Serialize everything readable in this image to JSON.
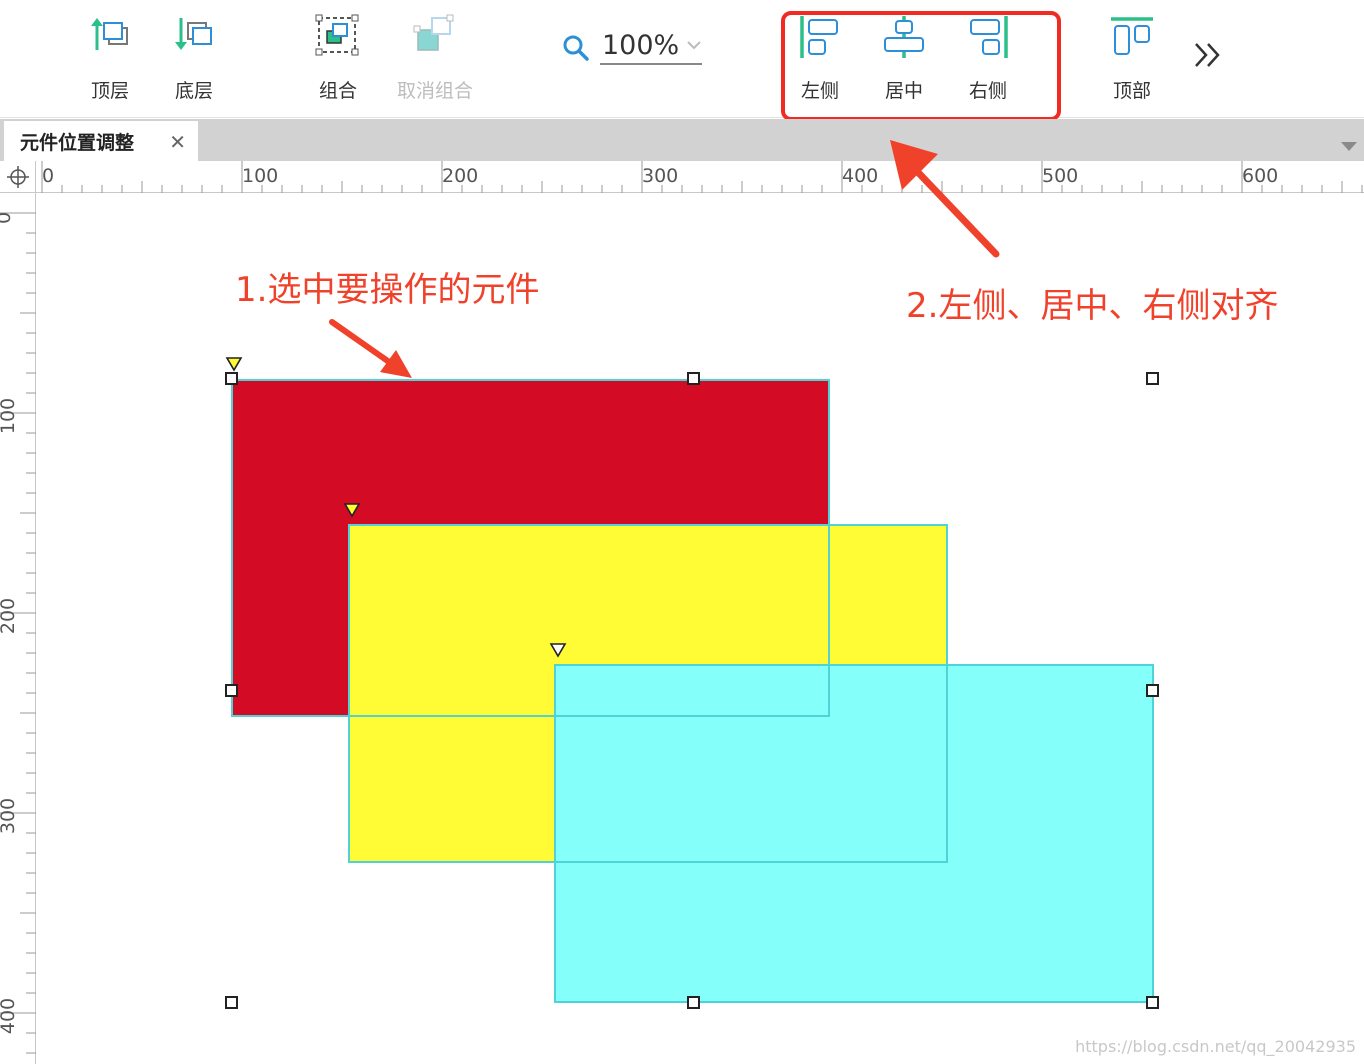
{
  "toolbar": {
    "top_layer": "顶层",
    "bottom_layer": "底层",
    "group": "组合",
    "ungroup": "取消组合",
    "zoom_value": "100%",
    "align_left": "左侧",
    "align_center": "居中",
    "align_right": "右侧",
    "align_top": "顶部"
  },
  "tab": {
    "title": "元件位置调整"
  },
  "rulers": {
    "horizontal": [
      "0",
      "100",
      "200",
      "300",
      "400",
      "500",
      "600"
    ],
    "vertical": [
      "0",
      "100",
      "200",
      "300",
      "400"
    ]
  },
  "canvas": {
    "shapes": [
      {
        "name": "red",
        "fill": "#d30b25"
      },
      {
        "name": "yellow",
        "fill": "#fffc36"
      },
      {
        "name": "cyan",
        "fill": "#84fffa"
      }
    ]
  },
  "annotations": {
    "step1": "1.选中要操作的元件",
    "step2": "2.左侧、居中、右侧对齐"
  },
  "watermark": "https://blog.csdn.net/qq_20042935",
  "colors": {
    "accent_green": "#2bbf8a",
    "accent_blue": "#2e8fd8",
    "annotation_red": "#f0422b"
  }
}
